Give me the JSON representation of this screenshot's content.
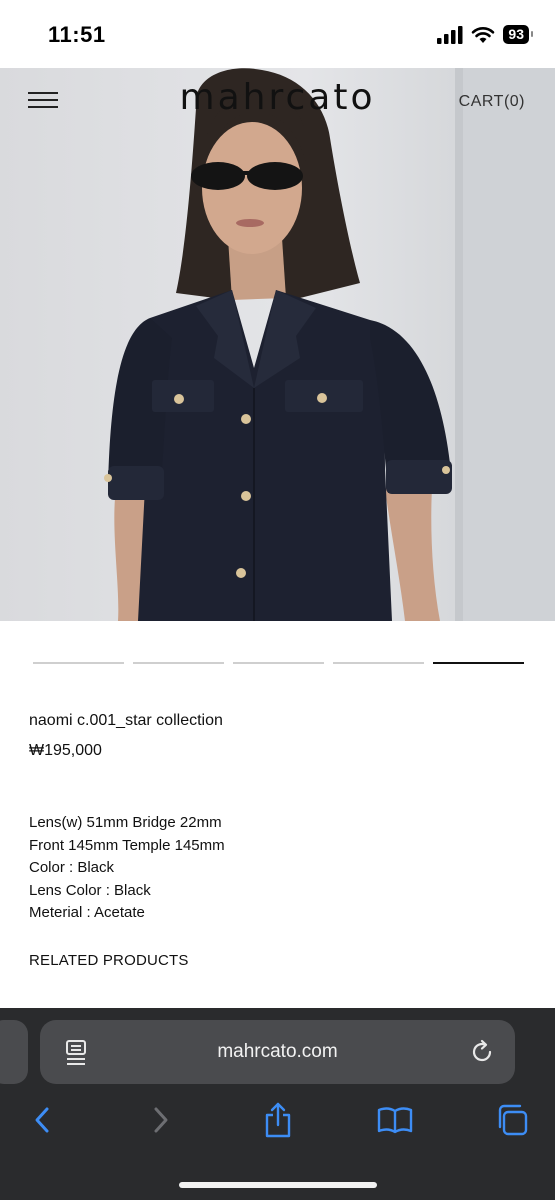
{
  "status_bar": {
    "time": "11:51",
    "battery": "93"
  },
  "header": {
    "logo": "mahrcato",
    "cart": "CART(0)"
  },
  "carousel": {
    "slides": 5,
    "active_index": 4
  },
  "product": {
    "name": "naomi c.001_star collection",
    "price": "₩195,000",
    "specs": [
      "Lens(w) 51mm Bridge 22mm",
      "Front 145mm Temple 145mm",
      "Color : Black",
      "Lens Color : Black",
      "Meterial : Acetate"
    ],
    "related_heading": "RELATED PRODUCTS"
  },
  "browser": {
    "url": "mahrcato.com",
    "accent": "#3d8df5",
    "toolbar_icons": [
      "back-icon",
      "forward-icon",
      "share-icon",
      "bookmarks-icon",
      "tabs-icon"
    ]
  }
}
